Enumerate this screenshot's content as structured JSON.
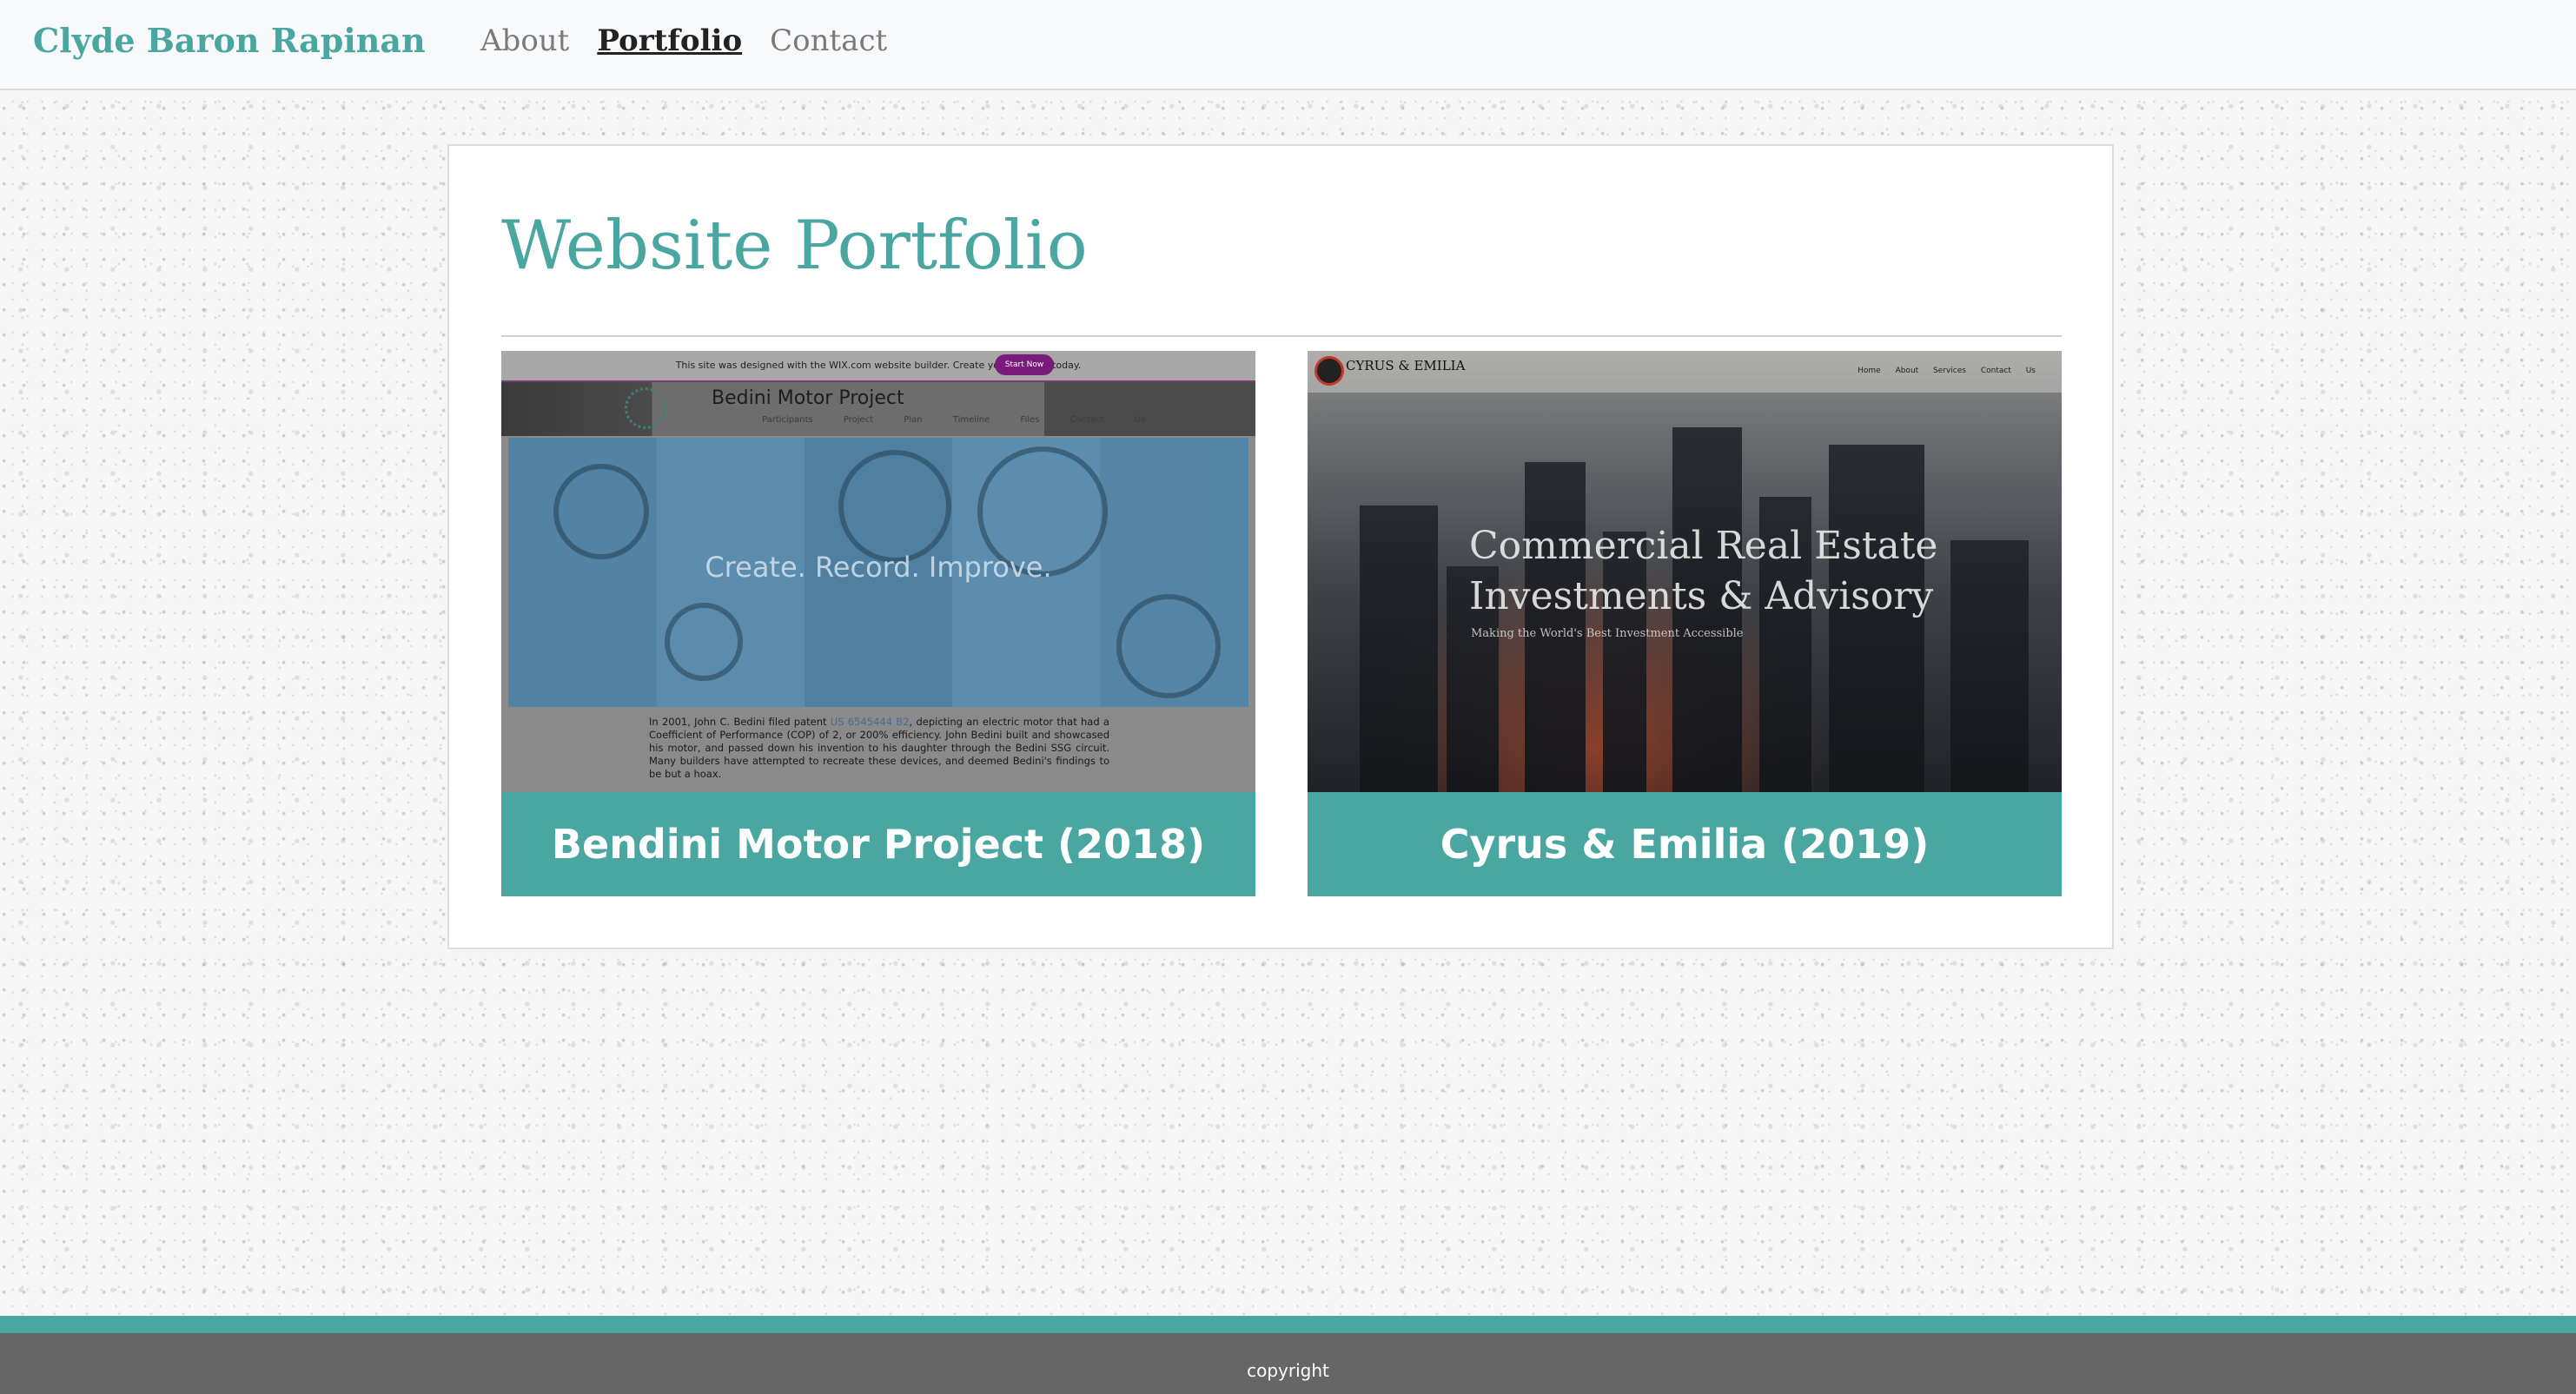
{
  "navbar": {
    "brand": "Clyde Baron Rapinan",
    "links": [
      {
        "label": "About",
        "active": false
      },
      {
        "label": "Portfolio",
        "active": true
      },
      {
        "label": "Contact",
        "active": false
      }
    ]
  },
  "main": {
    "title": "Website Portfolio",
    "projects": [
      {
        "caption": "Bendini Motor Project (2018)",
        "preview": {
          "banner_text": "This site was designed with the WIX.com website builder. Create your website today.",
          "banner_button": "Start Now",
          "site_title": "Bedini Motor Project",
          "menu": "Participants Project Plan Timeline Files Contact Us",
          "hero_text": "Create. Record. Improve.",
          "body_before_link": "In 2001, John C. Bedini filed patent ",
          "body_link": "US 6545444 B2",
          "body_after_link": ", depicting an electric motor that had a Coefficient of Performance (COP) of 2, or 200% efficiency. John Bedini built and showcased his motor, and passed down his invention to his daughter through the Bedini SSG circuit. Many builders have attempted to recreate these devices, and deemed Bedini's findings to be but a hoax."
        }
      },
      {
        "caption": "Cyrus & Emilia (2019)",
        "preview": {
          "brand": "CYRUS & EMILIA",
          "menu": "Home About Services Contact Us",
          "headline_line1": "Commercial Real Estate",
          "headline_line2": "Investments & Advisory",
          "subline": "Making the World's Best Investment Accessible"
        }
      }
    ]
  },
  "footer": {
    "text": "copyright"
  },
  "colors": {
    "accent": "#4aa6a0",
    "footer_bg": "#666666",
    "navbar_bg": "#f8f9fa"
  }
}
